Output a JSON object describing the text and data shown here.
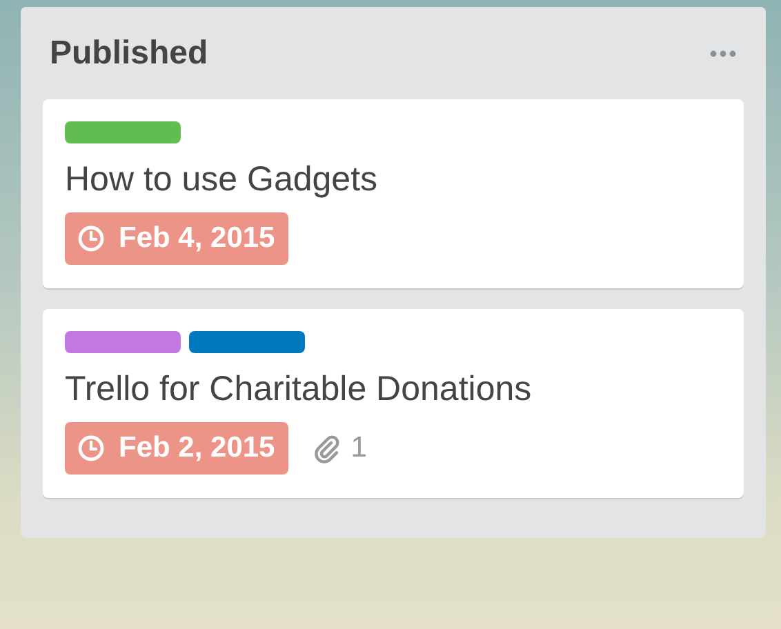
{
  "list": {
    "title": "Published",
    "cards": [
      {
        "labels": [
          {
            "color": "#61bd4f"
          }
        ],
        "title": "How to use Gadgets",
        "due": {
          "text": "Feb 4, 2015",
          "overdue": true
        }
      },
      {
        "labels": [
          {
            "color": "#c377e0"
          },
          {
            "color": "#0079bf"
          }
        ],
        "title": "Trello for Charitable Donations",
        "due": {
          "text": "Feb 2, 2015",
          "overdue": true
        },
        "attachments": "1"
      }
    ]
  }
}
